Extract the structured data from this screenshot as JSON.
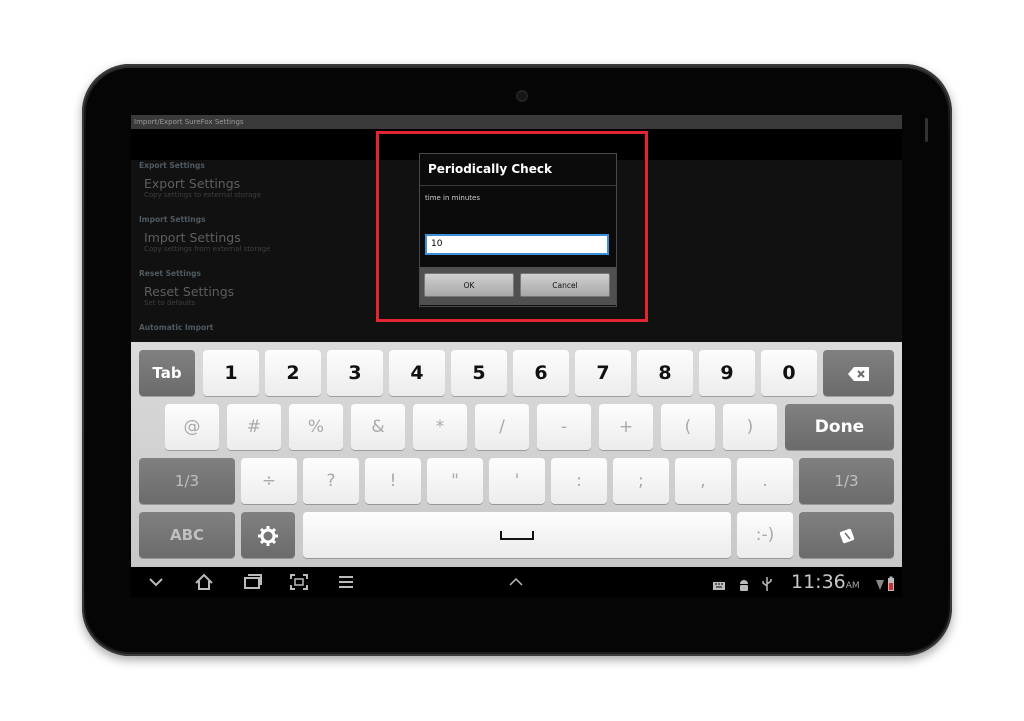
{
  "titlebar": {
    "title": "Import/Export SureFox Settings"
  },
  "settings": {
    "sections": [
      {
        "category": "Export Settings",
        "title": "Export Settings",
        "subtitle": "Copy settings to external storage"
      },
      {
        "category": "Import Settings",
        "title": "Import Settings",
        "subtitle": "Copy settings from external storage"
      },
      {
        "category": "Reset Settings",
        "title": "Reset Settings",
        "subtitle": "Set to defaults"
      }
    ],
    "last_category": "Automatic Import"
  },
  "dialog": {
    "title": "Periodically Check",
    "message": "time in minutes",
    "input_value": "10",
    "ok_label": "OK",
    "cancel_label": "Cancel"
  },
  "keyboard": {
    "row1": [
      "Tab",
      "1",
      "2",
      "3",
      "4",
      "5",
      "6",
      "7",
      "8",
      "9",
      "0"
    ],
    "row2": [
      "@",
      "#",
      "%",
      "&",
      "*",
      "/",
      "-",
      "+",
      "(",
      ")"
    ],
    "row2_done": "Done",
    "row3_left": "1/3",
    "row3": [
      "÷",
      "?",
      "!",
      "\"",
      "'",
      ":",
      ";",
      ",",
      "."
    ],
    "row3_right": "1/3",
    "row4_abc": "ABC",
    "row4_smiley": ":-)",
    "backspace_icon": "backspace-icon",
    "settings_icon": "gear-icon",
    "clipboard_icon": "clipboard-icon"
  },
  "navbar": {
    "icons": [
      "chevron-down-icon",
      "home-icon",
      "recent-apps-icon",
      "screenshot-icon",
      "menu-icon",
      "chevron-up-icon"
    ],
    "status_icons": [
      "keyboard-icon",
      "android-icon",
      "usb-icon",
      "wifi-icon",
      "battery-icon"
    ],
    "time": "11:36",
    "ampm": "AM"
  },
  "colors": {
    "highlight": "#e22530",
    "input_focus": "#3c8fd8",
    "category_text": "#5d6a72"
  }
}
